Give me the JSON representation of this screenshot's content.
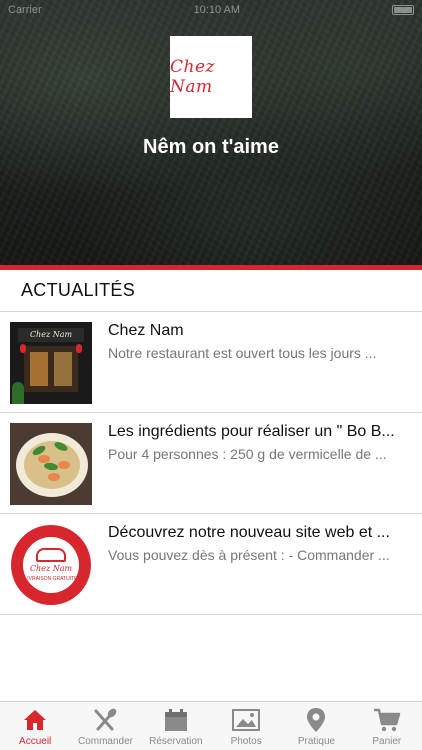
{
  "status_bar": {
    "carrier": "Carrier",
    "time": "10:10 AM"
  },
  "header": {
    "logo_text": "Chez Nam",
    "tagline": "Nêm on t'aime"
  },
  "section": {
    "title": "ACTUALITÉS"
  },
  "news": [
    {
      "title": "Chez Nam",
      "description": "Notre restaurant est ouvert tous les jours ...",
      "thumb_icon": "storefront-photo",
      "thumb_text": "Chez Nam"
    },
    {
      "title": "Les ingrédients pour réaliser un \" Bo B...",
      "description": "Pour 4 personnes : 250 g de vermicelle de ...",
      "thumb_icon": "noodle-bowl-photo"
    },
    {
      "title": "Découvrez notre nouveau site web et ...",
      "description": "Vous pouvez dès à présent : - Commander ...",
      "thumb_icon": "delivery-logo-image",
      "thumb_text": "Chez Nam",
      "thumb_small_text": "LIVRAISON GRATUITE"
    }
  ],
  "tabs": [
    {
      "label": "Accueil",
      "icon": "home-icon",
      "active": true
    },
    {
      "label": "Commander",
      "icon": "utensils-icon",
      "active": false
    },
    {
      "label": "Réservation",
      "icon": "calendar-icon",
      "active": false
    },
    {
      "label": "Photos",
      "icon": "photos-icon",
      "active": false
    },
    {
      "label": "Pratique",
      "icon": "location-pin-icon",
      "active": false
    },
    {
      "label": "Panier",
      "icon": "cart-icon",
      "active": false
    }
  ],
  "colors": {
    "accent": "#d8262f",
    "tab_inactive": "#8a8a8a",
    "divider": "#d9d9d9"
  }
}
